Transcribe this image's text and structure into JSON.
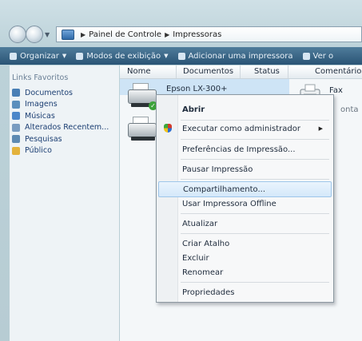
{
  "address": {
    "segments": [
      "Painel de Controle",
      "Impressoras"
    ]
  },
  "toolbar": {
    "items": [
      {
        "label": "Organizar",
        "has_menu": true
      },
      {
        "label": "Modos de exibição",
        "has_menu": true
      },
      {
        "label": "Adicionar uma impressora",
        "has_menu": false
      },
      {
        "label": "Ver o",
        "has_menu": false
      }
    ]
  },
  "left_pane": {
    "title": "Links Favoritos",
    "items": [
      {
        "label": "Documentos",
        "icon": "documents-icon",
        "color": "#4a7fb5"
      },
      {
        "label": "Imagens",
        "icon": "pictures-icon",
        "color": "#5b8fbd"
      },
      {
        "label": "Músicas",
        "icon": "music-icon",
        "color": "#4b86c9"
      },
      {
        "label": "Alterados Recentem...",
        "icon": "recent-icon",
        "color": "#7a9cc0"
      },
      {
        "label": "Pesquisas",
        "icon": "search-icon",
        "color": "#5e8ab2"
      },
      {
        "label": "Público",
        "icon": "public-folder-icon",
        "color": "#e3b23c"
      }
    ]
  },
  "columns": [
    "Nome",
    "Documentos",
    "Status",
    "Comentários"
  ],
  "printers": [
    {
      "name": "Epson LX-300+"
    }
  ],
  "fax": {
    "name": "Fax",
    "sub": "onta"
  },
  "context_menu": {
    "items": [
      {
        "label": "Abrir",
        "bold": true
      },
      {
        "label": "Executar como administrador",
        "submenu": true,
        "icon": "uac-shield-icon"
      },
      {
        "label": "Preferências de Impressão..."
      },
      {
        "label": "Pausar Impressão"
      },
      {
        "label": "Compartilhamento...",
        "highlighted": true
      },
      {
        "label": "Usar Impressora Offline"
      },
      {
        "label": "Atualizar"
      },
      {
        "label": "Criar Atalho"
      },
      {
        "label": "Excluir"
      },
      {
        "label": "Renomear"
      },
      {
        "label": "Propriedades"
      }
    ]
  }
}
